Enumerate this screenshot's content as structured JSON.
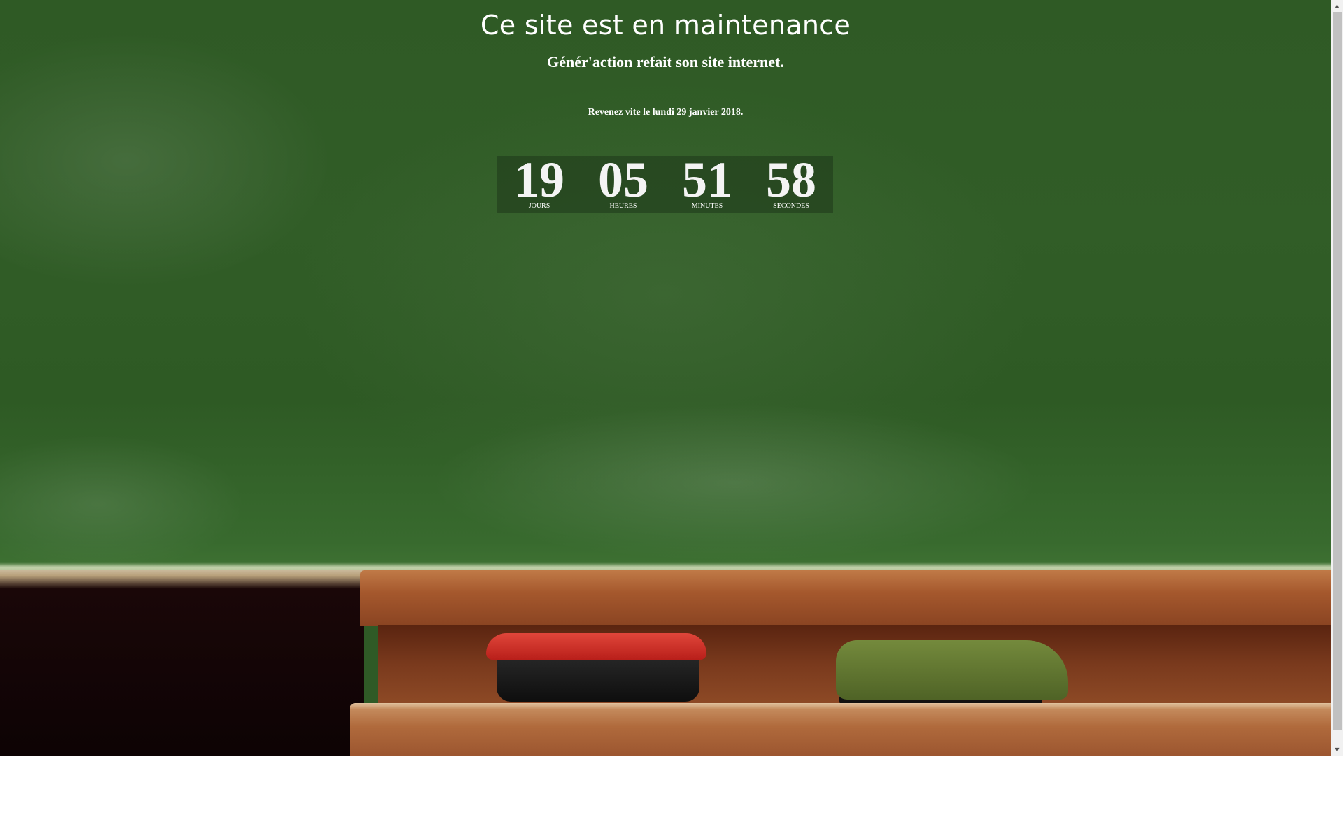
{
  "page": {
    "title": "Ce site est en maintenance",
    "subtitle": "Génér'action refait son site internet.",
    "return_note": "Revenez vite le lundi 29 janvier 2018."
  },
  "countdown": [
    {
      "value": "19",
      "label": "JOURS"
    },
    {
      "value": "05",
      "label": "HEURES"
    },
    {
      "value": "51",
      "label": "MINUTES"
    },
    {
      "value": "58",
      "label": "SECONDES"
    }
  ],
  "scrollbar": {
    "up_arrow": "▲",
    "down_arrow": "▼"
  },
  "colors": {
    "chalkboard": "#2f5a26",
    "text": "#ffffff",
    "tray_wood": "#a5582d"
  },
  "icons": {
    "scroll_up": "triangle-up-icon",
    "scroll_down": "triangle-down-icon"
  }
}
